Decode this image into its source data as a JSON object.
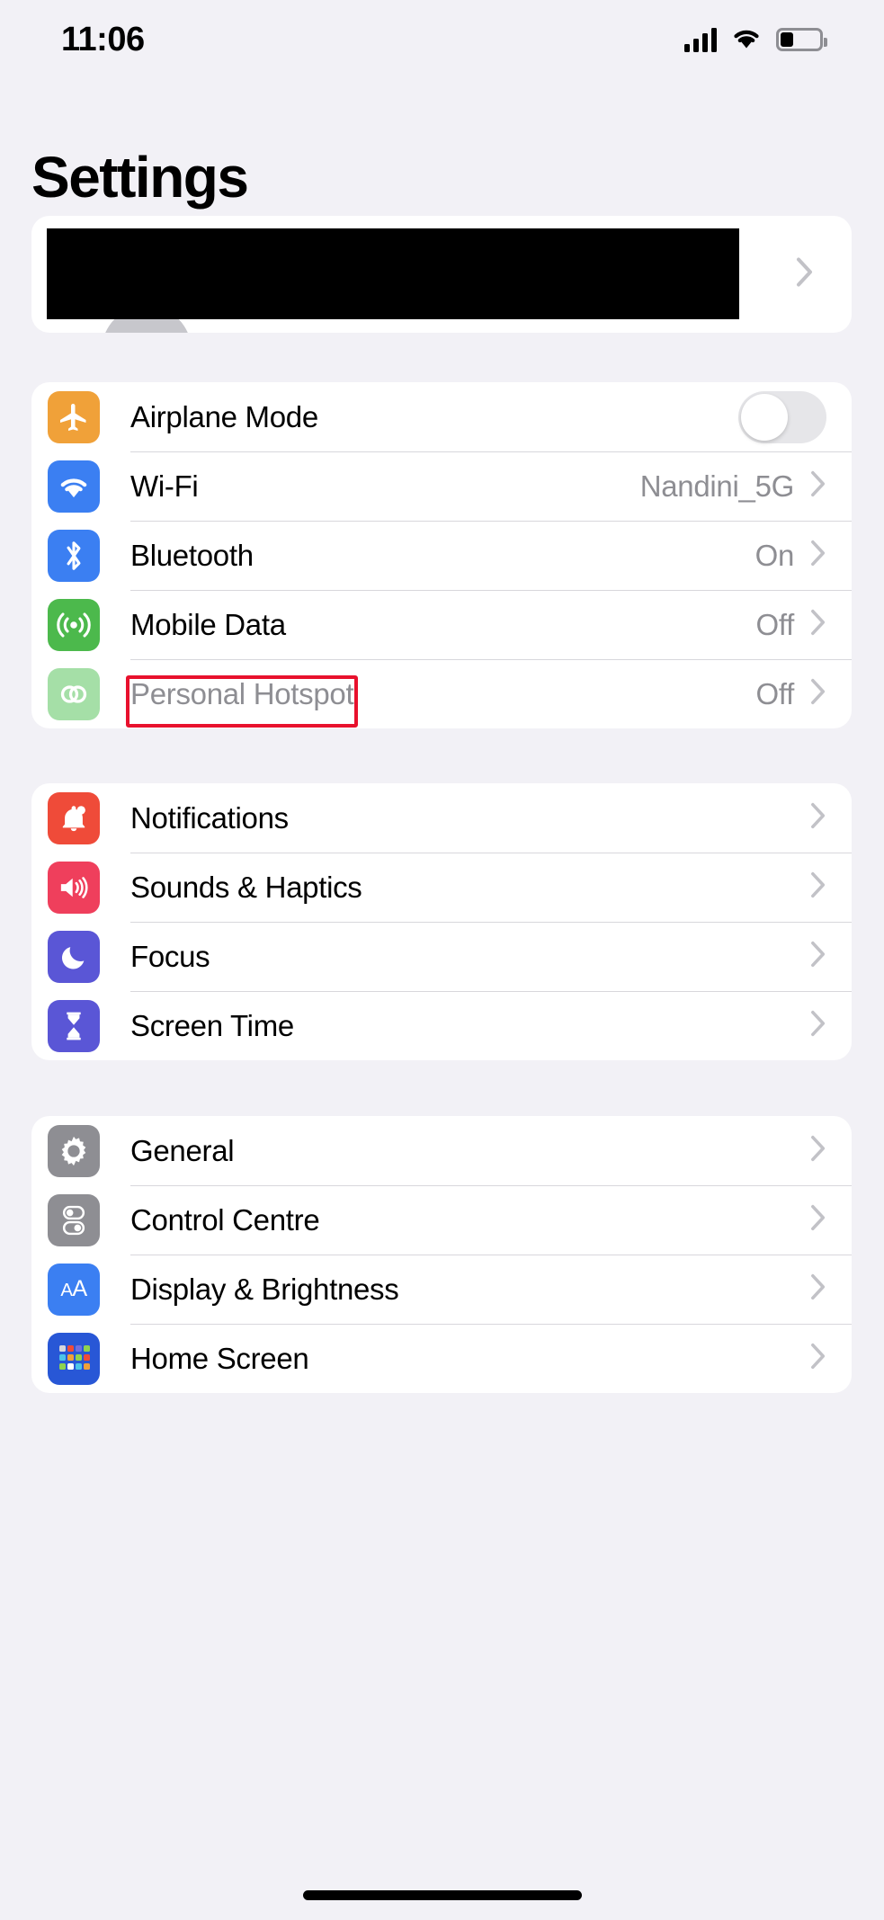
{
  "status_bar": {
    "time": "11:06",
    "signal_icon": "cellular-bars-icon",
    "wifi_icon": "wifi-icon",
    "battery_icon": "battery-low-icon"
  },
  "header": {
    "title": "Settings"
  },
  "apple_id_card": {
    "redacted": true,
    "chevron_icon": "chevron-right-icon",
    "avatar_icon": "avatar-icon"
  },
  "groups": [
    {
      "id": "connectivity",
      "rows": [
        {
          "label": "Airplane Mode",
          "icon": "airplane-icon",
          "icon_color": "#f0a139",
          "control": "toggle",
          "toggle_on": false,
          "value": "",
          "disabled": false
        },
        {
          "label": "Wi-Fi",
          "icon": "wifi-icon",
          "icon_color": "#3b7ff2",
          "control": "chevron",
          "value": "Nandini_5G",
          "disabled": false
        },
        {
          "label": "Bluetooth",
          "icon": "bluetooth-icon",
          "icon_color": "#3b7ff2",
          "control": "chevron",
          "value": "On",
          "disabled": false
        },
        {
          "label": "Mobile Data",
          "icon": "mobile-data-icon",
          "icon_color": "#4cb94c",
          "control": "chevron",
          "value": "Off",
          "disabled": false
        },
        {
          "label": "Personal Hotspot",
          "icon": "hotspot-icon",
          "icon_color": "#a5dfa7",
          "control": "chevron",
          "value": "Off",
          "disabled": true,
          "highlighted": true
        }
      ]
    },
    {
      "id": "alerts",
      "rows": [
        {
          "label": "Notifications",
          "icon": "bell-icon",
          "icon_color": "#ef4b39",
          "control": "chevron",
          "value": "",
          "disabled": false
        },
        {
          "label": "Sounds & Haptics",
          "icon": "speaker-icon",
          "icon_color": "#ef3f5c",
          "control": "chevron",
          "value": "",
          "disabled": false
        },
        {
          "label": "Focus",
          "icon": "moon-icon",
          "icon_color": "#5a56d6",
          "control": "chevron",
          "value": "",
          "disabled": false
        },
        {
          "label": "Screen Time",
          "icon": "hourglass-icon",
          "icon_color": "#5a56d6",
          "control": "chevron",
          "value": "",
          "disabled": false
        }
      ]
    },
    {
      "id": "system",
      "rows": [
        {
          "label": "General",
          "icon": "gear-icon",
          "icon_color": "#8e8e93",
          "control": "chevron",
          "value": "",
          "disabled": false
        },
        {
          "label": "Control Centre",
          "icon": "control-centre-icon",
          "icon_color": "#8e8e93",
          "control": "chevron",
          "value": "",
          "disabled": false
        },
        {
          "label": "Display & Brightness",
          "icon": "display-brightness-icon",
          "icon_color": "#3b7ff2",
          "control": "chevron",
          "value": "",
          "disabled": false
        },
        {
          "label": "Home Screen",
          "icon": "home-screen-icon",
          "icon_color": "#2857d6",
          "control": "chevron",
          "value": "",
          "disabled": false
        }
      ]
    }
  ],
  "annotation": {
    "color": "#e8112d",
    "target": "Personal Hotspot"
  },
  "home_indicator": true
}
